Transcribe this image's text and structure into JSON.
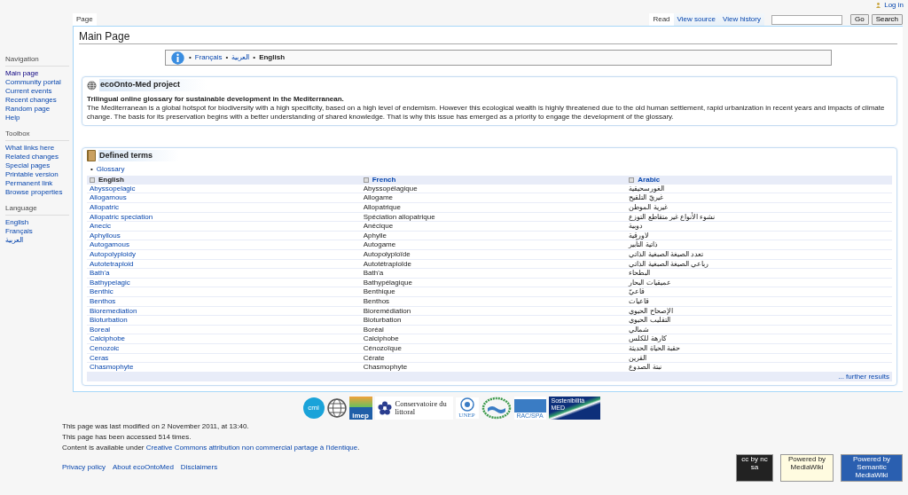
{
  "personal": {
    "login": "Log in"
  },
  "left_tabs": [
    {
      "label": "Page",
      "selected": true
    }
  ],
  "right_tabs": [
    {
      "label": "Read",
      "selected": true
    },
    {
      "label": "View source",
      "selected": false
    },
    {
      "label": "View history",
      "selected": false
    }
  ],
  "search": {
    "go": "Go",
    "search": "Search"
  },
  "sidebar": [
    {
      "heading": "Navigation",
      "items": [
        {
          "label": "Main page",
          "selected": true
        },
        {
          "label": "Community portal",
          "selected": false
        },
        {
          "label": "Current events",
          "selected": false
        },
        {
          "label": "Recent changes",
          "selected": false
        },
        {
          "label": "Random page",
          "selected": false
        },
        {
          "label": "Help",
          "selected": false
        }
      ]
    },
    {
      "heading": "Toolbox",
      "items": [
        {
          "label": "What links here",
          "selected": false
        },
        {
          "label": "Related changes",
          "selected": false
        },
        {
          "label": "Special pages",
          "selected": false
        },
        {
          "label": "Printable version",
          "selected": false
        },
        {
          "label": "Permanent link",
          "selected": false
        },
        {
          "label": "Browse properties",
          "selected": false
        }
      ]
    },
    {
      "heading": "Language",
      "items": [
        {
          "label": "English",
          "selected": false
        },
        {
          "label": "Français",
          "selected": false
        },
        {
          "label": "العربية",
          "selected": false
        }
      ]
    }
  ],
  "title": "Main Page",
  "languages": {
    "bullet": "•",
    "items": [
      {
        "label": "Français",
        "selected": false
      },
      {
        "label": "العربية",
        "selected": false
      },
      {
        "label": "English",
        "selected": true
      }
    ]
  },
  "project": {
    "title": "ecoOnto-Med project",
    "lead": "Trilingual online glossary for sustainable development in the Mediterranean.",
    "text": "The Mediterranean is a global hotspot for biodiversity with a high specificity, based on a high level of endemism. However this ecological wealth is highly threatened due to the old human settlement, rapid urbanization in recent years and impacts of climate change. The basis for its preservation begins with a better understanding of shared knowledge. That is why this issue has emerged as a priority to engage the development of the glossary."
  },
  "terms": {
    "title": "Defined terms",
    "link_bullet": "•",
    "links": [
      "Glossary"
    ],
    "columns": [
      {
        "label": "English",
        "sorted": true
      },
      {
        "label": "French",
        "sorted": false
      },
      {
        "label": "Arabic",
        "sorted": false
      }
    ],
    "rows": [
      [
        "Abyssopelagic",
        "Abyssopélagique",
        "الغورسحيقية"
      ],
      [
        "Allogamous",
        "Allogame",
        "غيريّ التلقيح"
      ],
      [
        "Allopatric",
        "Allopatrique",
        "غيرية الموطن"
      ],
      [
        "Allopatric speciation",
        "Spéciation allopatrique",
        "نشوء الأنواع غير متقاطع التوزع"
      ],
      [
        "Anecic",
        "Anécique",
        "دوبية"
      ],
      [
        "Aphyllous",
        "Aphylle",
        "لاورقية"
      ],
      [
        "Autogamous",
        "Autogame",
        "ذاتية التأبير"
      ],
      [
        "Autopolyploidy",
        "Autopolyploïde",
        "تعدد الصيغة الصبغية الذاتي"
      ],
      [
        "Autotetraploid",
        "Autotétraploïde",
        "رباعي الصيغة الصبغية الذاتي"
      ],
      [
        "Bath'a",
        "Bath'a",
        "البطحاء"
      ],
      [
        "Bathypelagic",
        "Bathypélagique",
        "عميقيات البحار"
      ],
      [
        "Benthic",
        "Benthique",
        "قاعيّ"
      ],
      [
        "Benthos",
        "Benthos",
        "قاعيات"
      ],
      [
        "Bioremediation",
        "Bioremédiation",
        "الإصحاح الحيوي"
      ],
      [
        "Bioturbation",
        "Bioturbation",
        "التقليب الحيوي"
      ],
      [
        "Boreal",
        "Boréal",
        "شمالي"
      ],
      [
        "Calciphobe",
        "Calciphobe",
        "كارهة للكلس"
      ],
      [
        "Cenozoic",
        "Cénozoïque",
        "حقبة الحياة الحديثة"
      ],
      [
        "Ceras",
        "Cérate",
        "القرين"
      ],
      [
        "Chasmophyte",
        "Chasmophyte",
        "نبتة الصدوع"
      ]
    ],
    "more": "... further results"
  },
  "partner_logos": [
    {
      "kind": "cmi",
      "text": "cmi"
    },
    {
      "kind": "globe"
    },
    {
      "kind": "imep",
      "text": "imep"
    },
    {
      "kind": "conservatoire",
      "text": "Conservatoire du littoral"
    },
    {
      "kind": "unep",
      "text": "UNEP"
    },
    {
      "kind": "wreath"
    },
    {
      "kind": "racspa",
      "text": "RAC/SPA"
    },
    {
      "kind": "med",
      "text": "Sostenibilità MED"
    }
  ],
  "footer": {
    "modified": "This page was last modified on 2 November 2011, at 13:40.",
    "accessed": "This page has been accessed 514 times.",
    "license_prefix": "Content is available under ",
    "license_link": "Creative Commons attribution non commercial partage à l'identique",
    "license_suffix": ".",
    "links": [
      "Privacy policy",
      "About ecoOntoMed",
      "Disclaimers"
    ]
  },
  "badges": [
    {
      "kind": "cc",
      "text": "cc by nc sa"
    },
    {
      "kind": "mw",
      "text": "Powered by MediaWiki"
    },
    {
      "kind": "smw",
      "text": "Powered by Semantic MediaWiki"
    }
  ]
}
